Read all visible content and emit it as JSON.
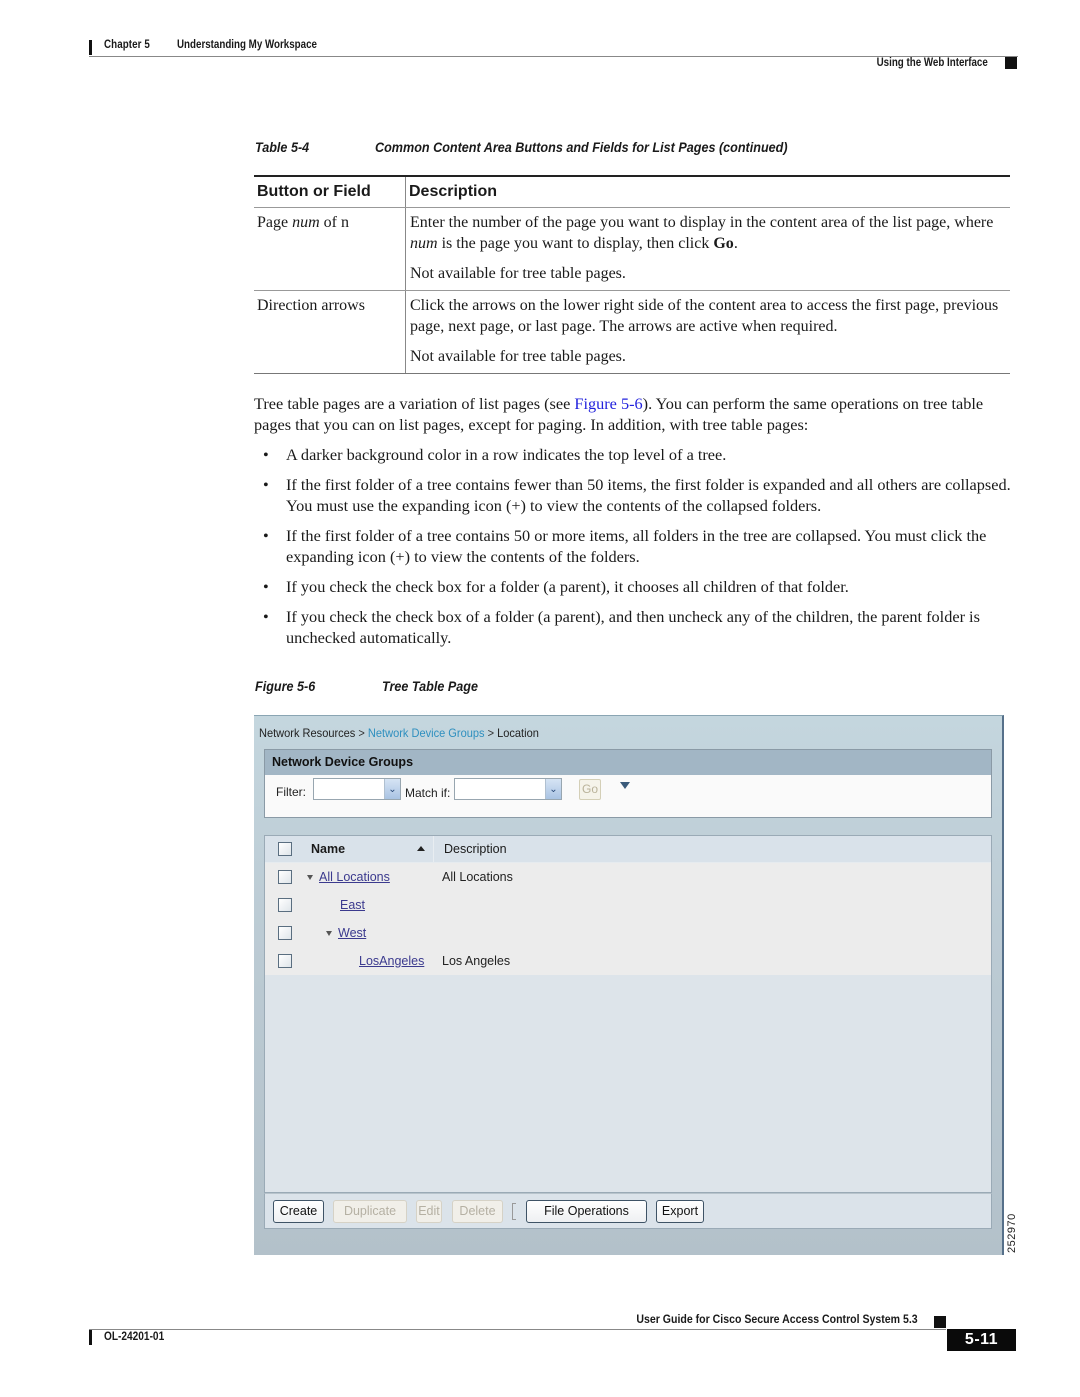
{
  "header": {
    "chapter": "Chapter 5",
    "chapter_title": "Understanding My Workspace",
    "section": "Using the Web Interface"
  },
  "table": {
    "caption_number": "Table 5-4",
    "caption_title": "Common Content Area Buttons and Fields for List Pages (continued)",
    "columns": [
      "Button or Field",
      "Description"
    ],
    "rows": [
      {
        "field_pre": "Page ",
        "field_em": "num",
        "field_post": " of n",
        "desc_1_pre": "Enter the number of the page you want to display in the content area of the list page, where ",
        "desc_1_em": "num",
        "desc_1_mid": " is the page you want to display, then click ",
        "desc_1_bold": "Go",
        "desc_1_post": ".",
        "desc_2": "Not available for tree table pages."
      },
      {
        "field": "Direction arrows",
        "desc_1": "Click the arrows on the lower right side of the content area to access the first page, previous page, next page, or last page. The arrows are active when required.",
        "desc_2": "Not available for tree table pages."
      }
    ]
  },
  "body": {
    "intro_pre": "Tree table pages are a variation of list pages (see ",
    "intro_link": "Figure 5-6",
    "intro_post": "). You can perform the same operations on tree table pages that you can on list pages, except for paging. In addition, with tree table pages:",
    "bullets": [
      "A darker background color in a row indicates the top level of a tree.",
      "If the first folder of a tree contains fewer than 50 items, the first folder is expanded and all others are collapsed. You must use the expanding icon (+) to view the contents of the collapsed folders.",
      "If the first folder of a tree contains 50 or more items, all folders in the tree are collapsed. You must click the expanding icon (+) to view the contents of the folders.",
      "If you check the check box for a folder (a parent), it chooses all children of that folder.",
      "If you check the check box of a folder (a parent), and then uncheck any of the children, the parent folder is unchecked automatically."
    ]
  },
  "figure": {
    "caption_number": "Figure 5-6",
    "caption_title": "Tree Table Page",
    "figure_id": "252970",
    "screenshot": {
      "breadcrumb": [
        "Network Resources",
        "Network Device Groups",
        "Location"
      ],
      "breadcrumb_sep": ">",
      "panel_title": "Network Device Groups",
      "filter_label": "Filter:",
      "filter_value": "",
      "match_if_label": "Match if:",
      "match_if_value": "",
      "go_label": "Go",
      "columns": {
        "name": "Name",
        "description": "Description"
      },
      "rows": [
        {
          "name": "All Locations",
          "description": "All Locations",
          "level": 0,
          "expanded": true
        },
        {
          "name": "East",
          "description": "",
          "level": 1,
          "expanded": null
        },
        {
          "name": "West",
          "description": "",
          "level": 1,
          "expanded": true
        },
        {
          "name": "LosAngeles",
          "description": "Los Angeles",
          "level": 2,
          "expanded": null
        }
      ],
      "buttons": [
        {
          "label": "Create",
          "enabled": true
        },
        {
          "label": "Duplicate",
          "enabled": false
        },
        {
          "label": "Edit",
          "enabled": false
        },
        {
          "label": "Delete",
          "enabled": false
        },
        {
          "label": "File Operations",
          "enabled": true
        },
        {
          "label": "Export",
          "enabled": true
        }
      ]
    }
  },
  "footer": {
    "guide_title": "User Guide for Cisco Secure Access Control System 5.3",
    "doc_number": "OL-24201-01",
    "page_number": "5-11"
  }
}
